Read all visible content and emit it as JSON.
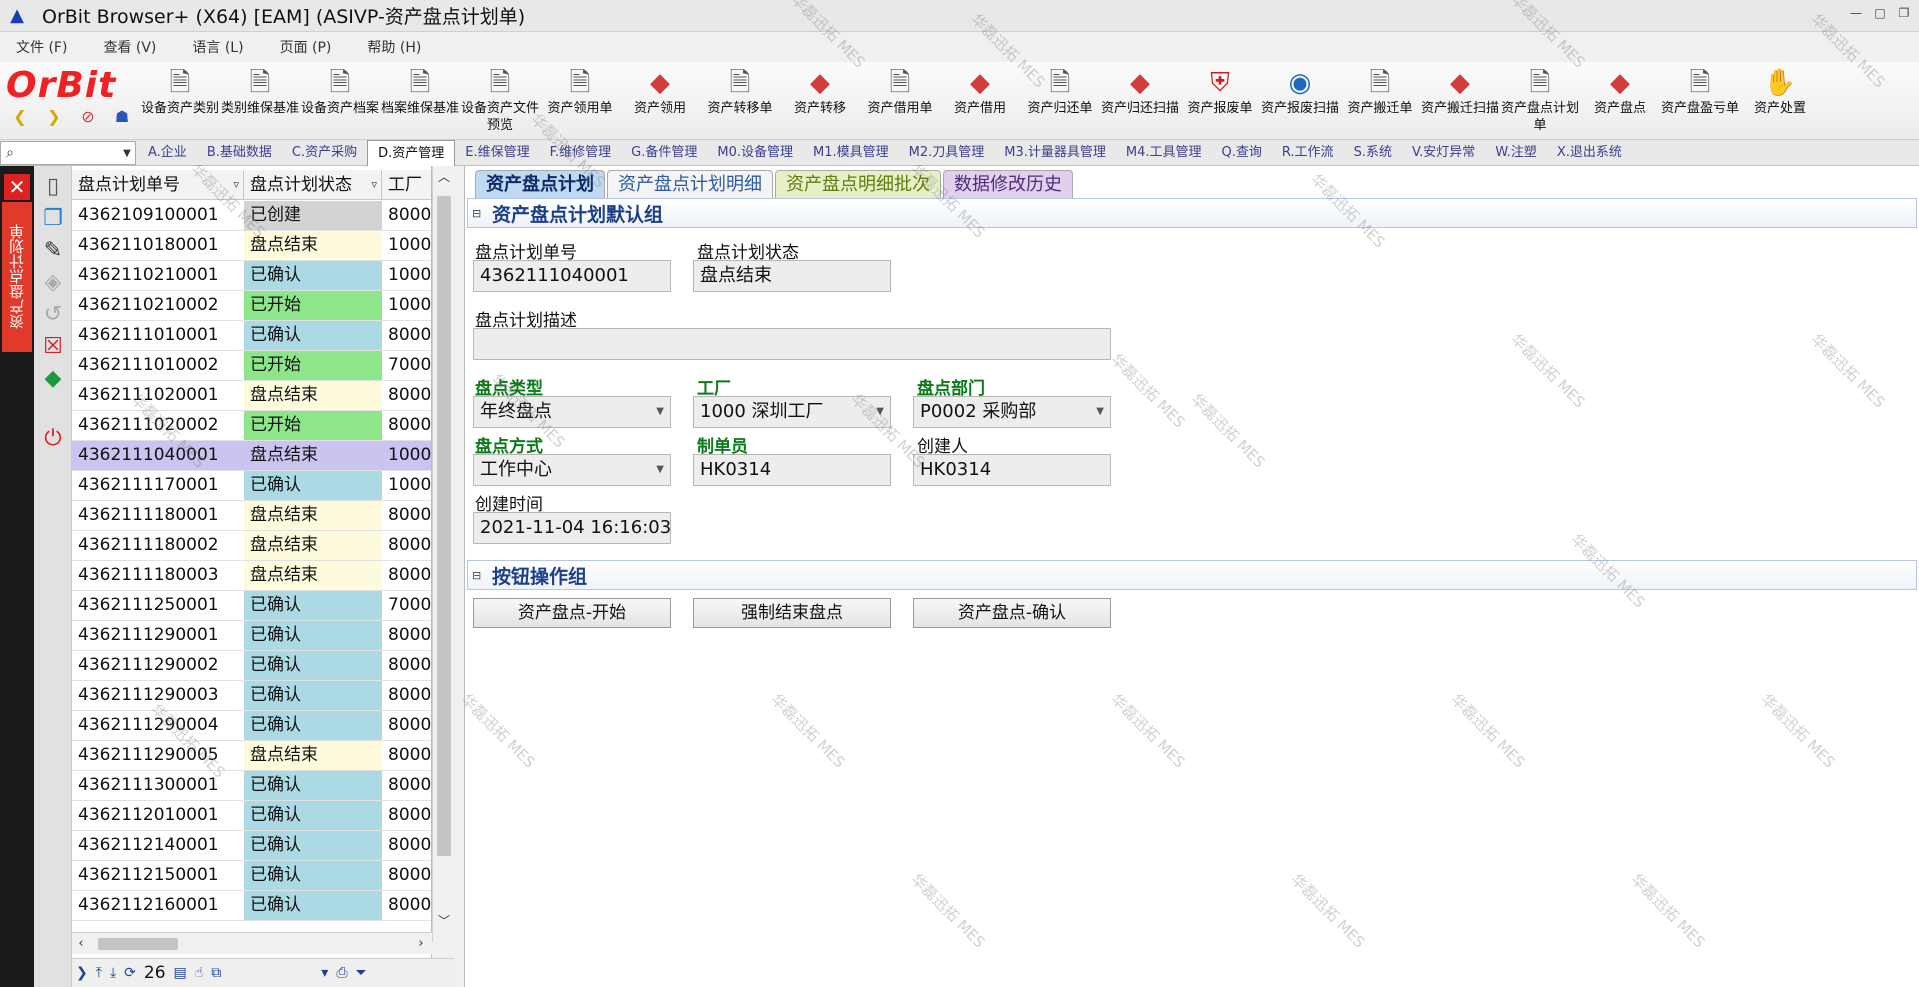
{
  "window": {
    "title": "OrBit Browser+ (X64) [EAM] (ASIVP-资产盘点计划单)"
  },
  "menu": [
    "文件 (F)",
    "查看 (V)",
    "语言 (L)",
    "页面 (P)",
    "帮助 (H)"
  ],
  "logo": "OrBit",
  "toolbar": {
    "buttons": [
      {
        "label": "设备资产类别",
        "icon": "document-stack-icon"
      },
      {
        "label": "类别维保基准",
        "icon": "document-stack-icon"
      },
      {
        "label": "设备资产档案",
        "icon": "document-stack-icon"
      },
      {
        "label": "档案维保基准",
        "icon": "document-stack-icon"
      },
      {
        "label": "设备资产文件预览",
        "icon": "document-stack-icon"
      },
      {
        "label": "资产领用单",
        "icon": "document-stack-icon"
      },
      {
        "label": "资产领用",
        "icon": "cubes-icon"
      },
      {
        "label": "资产转移单",
        "icon": "document-stack-icon"
      },
      {
        "label": "资产转移",
        "icon": "cubes-icon"
      },
      {
        "label": "资产借用单",
        "icon": "document-stack-icon"
      },
      {
        "label": "资产借用",
        "icon": "cubes-icon"
      },
      {
        "label": "资产归还单",
        "icon": "document-stack-icon"
      },
      {
        "label": "资产归还扫描",
        "icon": "cubes-icon"
      },
      {
        "label": "资产报废单",
        "icon": "shield-icon"
      },
      {
        "label": "资产报废扫描",
        "icon": "globe-icon"
      },
      {
        "label": "资产搬迁单",
        "icon": "document-stack-icon"
      },
      {
        "label": "资产搬迁扫描",
        "icon": "cubes-icon"
      },
      {
        "label": "资产盘点计划单",
        "icon": "document-stack-icon"
      },
      {
        "label": "资产盘点",
        "icon": "cubes-icon"
      },
      {
        "label": "资产盘盈亏单",
        "icon": "document-stack-icon"
      },
      {
        "label": "资产处置",
        "icon": "hand-icon"
      }
    ]
  },
  "nav_tabs": [
    {
      "label": "A.企业",
      "active": false
    },
    {
      "label": "B.基础数据",
      "active": false
    },
    {
      "label": "C.资产采购",
      "active": false
    },
    {
      "label": "D.资产管理",
      "active": true
    },
    {
      "label": "E.维保管理",
      "active": false
    },
    {
      "label": "F.维修管理",
      "active": false
    },
    {
      "label": "G.备件管理",
      "active": false
    },
    {
      "label": "M0.设备管理",
      "active": false
    },
    {
      "label": "M1.模具管理",
      "active": false
    },
    {
      "label": "M2.刀具管理",
      "active": false
    },
    {
      "label": "M3.计量器具管理",
      "active": false
    },
    {
      "label": "M4.工具管理",
      "active": false
    },
    {
      "label": "Q.查询",
      "active": false
    },
    {
      "label": "R.工作流",
      "active": false
    },
    {
      "label": "S.系统",
      "active": false
    },
    {
      "label": "V.安灯异常",
      "active": false
    },
    {
      "label": "W.注塑",
      "active": false
    },
    {
      "label": "X.退出系统",
      "active": false
    }
  ],
  "side_tab": "资产盘点计划单",
  "grid": {
    "columns": [
      "盘点计划单号",
      "盘点计划状态",
      "工厂"
    ],
    "rows": [
      {
        "no": "4362109100001",
        "status": "已创建",
        "factory": "8000",
        "kind": "created"
      },
      {
        "no": "4362110180001",
        "status": "盘点结束",
        "factory": "1000",
        "kind": "ended"
      },
      {
        "no": "4362110210001",
        "status": "已确认",
        "factory": "1000",
        "kind": "confirmed"
      },
      {
        "no": "4362110210002",
        "status": "已开始",
        "factory": "1000",
        "kind": "started"
      },
      {
        "no": "4362111010001",
        "status": "已确认",
        "factory": "8000",
        "kind": "confirmed"
      },
      {
        "no": "4362111010002",
        "status": "已开始",
        "factory": "7000",
        "kind": "started"
      },
      {
        "no": "4362111020001",
        "status": "盘点结束",
        "factory": "8000",
        "kind": "ended"
      },
      {
        "no": "4362111020002",
        "status": "已开始",
        "factory": "8000",
        "kind": "started"
      },
      {
        "no": "4362111040001",
        "status": "盘点结束",
        "factory": "1000",
        "kind": "selected"
      },
      {
        "no": "4362111170001",
        "status": "已确认",
        "factory": "1000",
        "kind": "confirmed"
      },
      {
        "no": "4362111180001",
        "status": "盘点结束",
        "factory": "8000",
        "kind": "ended"
      },
      {
        "no": "4362111180002",
        "status": "盘点结束",
        "factory": "8000",
        "kind": "ended"
      },
      {
        "no": "4362111180003",
        "status": "盘点结束",
        "factory": "8000",
        "kind": "ended"
      },
      {
        "no": "4362111250001",
        "status": "已确认",
        "factory": "7000",
        "kind": "confirmed"
      },
      {
        "no": "4362111290001",
        "status": "已确认",
        "factory": "8000",
        "kind": "confirmed"
      },
      {
        "no": "4362111290002",
        "status": "已确认",
        "factory": "8000",
        "kind": "confirmed"
      },
      {
        "no": "4362111290003",
        "status": "已确认",
        "factory": "8000",
        "kind": "confirmed"
      },
      {
        "no": "4362111290004",
        "status": "已确认",
        "factory": "8000",
        "kind": "confirmed"
      },
      {
        "no": "4362111290005",
        "status": "盘点结束",
        "factory": "8000",
        "kind": "ended"
      },
      {
        "no": "4362111300001",
        "status": "已确认",
        "factory": "8000",
        "kind": "confirmed"
      },
      {
        "no": "4362112010001",
        "status": "已确认",
        "factory": "8000",
        "kind": "confirmed"
      },
      {
        "no": "4362112140001",
        "status": "已确认",
        "factory": "8000",
        "kind": "confirmed"
      },
      {
        "no": "4362112150001",
        "status": "已确认",
        "factory": "8000",
        "kind": "confirmed"
      },
      {
        "no": "4362112160001",
        "status": "已确认",
        "factory": "8000",
        "kind": "confirmed"
      }
    ],
    "record_count": "26"
  },
  "panel": {
    "tabs": [
      "资产盘点计划",
      "资产盘点计划明细",
      "资产盘点明细批次",
      "数据修改历史"
    ],
    "section_default": "资产盘点计划默认组",
    "section_buttons": "按钮操作组",
    "fields": {
      "plan_no_label": "盘点计划单号",
      "plan_no": "4362111040001",
      "plan_status_label": "盘点计划状态",
      "plan_status": "盘点结束",
      "desc_label": "盘点计划描述",
      "desc": "",
      "type_label": "盘点类型",
      "type": "年终盘点",
      "factory_label": "工厂",
      "factory": "1000 深圳工厂",
      "dept_label": "盘点部门",
      "dept": "P0002 采购部",
      "method_label": "盘点方式",
      "method": "工作中心",
      "maker_label": "制单员",
      "maker": "HK0314",
      "creator_label": "创建人",
      "creator": "HK0314",
      "created_time_label": "创建时间",
      "created_time": "2021-11-04 16:16:03"
    },
    "buttons": [
      "资产盘点-开始",
      "强制结束盘点",
      "资产盘点-确认"
    ]
  },
  "watermark": "华磊迅拓 MES",
  "colors": {
    "status_created": "#d3d3d3",
    "status_ended": "#fdfbdc",
    "status_confirmed": "#abd9e4",
    "status_started": "#8ee68b",
    "selected_row": "#c9c4f0",
    "required_label": "#0b7a18"
  }
}
